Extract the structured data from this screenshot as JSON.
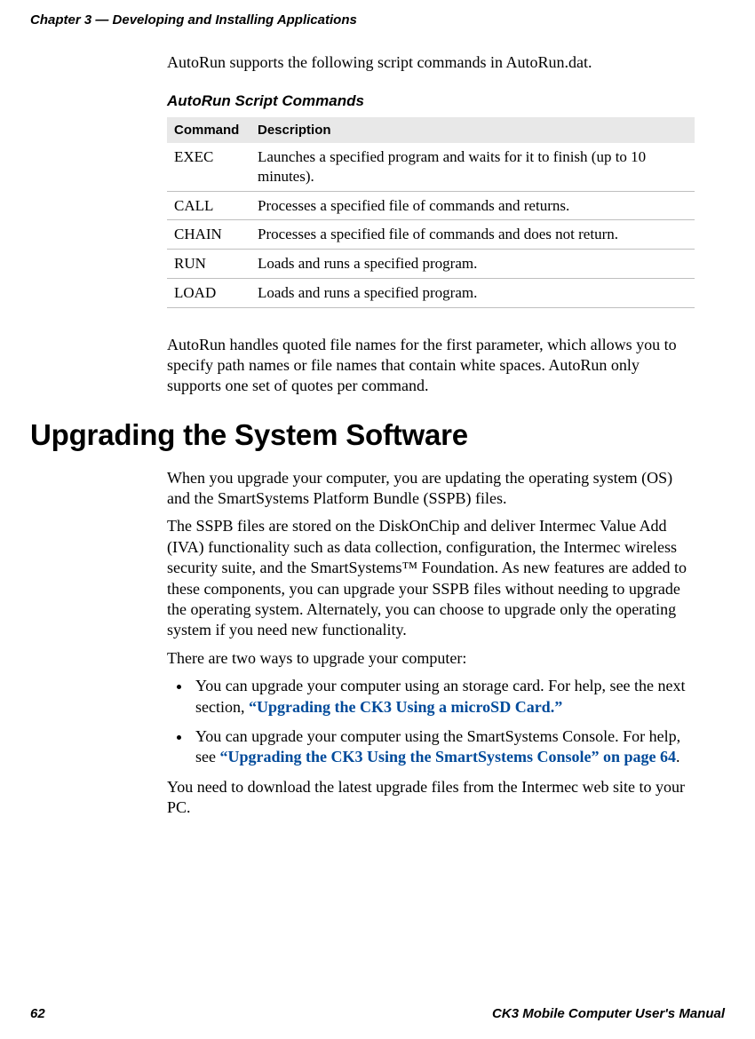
{
  "header": {
    "chapter": "Chapter 3 — Developing and Installing Applications"
  },
  "intro": "AutoRun supports the following script commands in AutoRun.dat.",
  "table": {
    "title": "AutoRun Script Commands",
    "headers": {
      "command": "Command",
      "description": "Description"
    },
    "rows": [
      {
        "command": "EXEC",
        "description": "Launches a specified program and waits for it to finish (up to 10 minutes)."
      },
      {
        "command": "CALL",
        "description": "Processes a specified file of commands and returns."
      },
      {
        "command": "CHAIN",
        "description": "Processes a specified file of commands and does not return."
      },
      {
        "command": "RUN",
        "description": "Loads and runs a specified program."
      },
      {
        "command": "LOAD",
        "description": "Loads and runs a specified program."
      }
    ]
  },
  "para_after_table": "AutoRun handles quoted file names for the first parameter, which allows you to specify path names or file names that contain white spaces. AutoRun only supports one set of quotes per command.",
  "heading1": "Upgrading the System Software",
  "p1": "When you upgrade your computer, you are updating the operating system (OS) and the SmartSystems Platform Bundle (SSPB) files.",
  "p2": "The SSPB files are stored on the DiskOnChip and deliver Intermec Value Add (IVA) functionality such as data collection, configuration, the Intermec wireless security suite, and the SmartSystems™ Foundation. As new features are added to these components, you can upgrade your SSPB files without needing to upgrade the operating system. Alternately, you can choose to upgrade only the operating system if you need new functionality.",
  "p3": "There are two ways to upgrade your computer:",
  "bullets": {
    "b1_pre": "You can upgrade your computer using an storage card. For help, see the next section, ",
    "b1_link": "“Upgrading the CK3 Using a microSD Card.”",
    "b2_pre": "You can upgrade your computer using the SmartSystems Console. For help, see ",
    "b2_link": "“Upgrading the CK3 Using the SmartSystems Console” on page 64",
    "b2_post": "."
  },
  "p4": "You need to download the latest upgrade files from the Intermec web site to your PC.",
  "footer": {
    "page": "62",
    "title": "CK3 Mobile Computer User's Manual"
  }
}
